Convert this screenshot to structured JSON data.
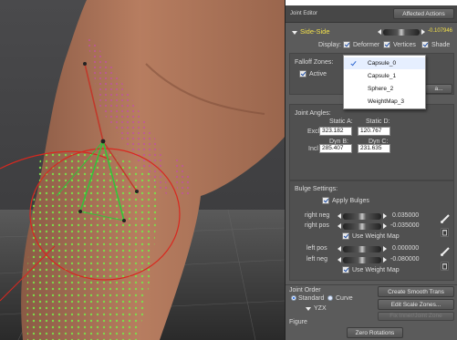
{
  "panel": {
    "title": "Joint Editor",
    "affected_actions_label": "Affected Actions",
    "parameter_name": "Side-Side",
    "parameter_value": "-0.107946",
    "display_label": "Display:",
    "display_options": [
      {
        "label": "Deformer",
        "checked": true
      },
      {
        "label": "Vertices",
        "checked": true
      },
      {
        "label": "Shade",
        "checked": false
      }
    ]
  },
  "falloff": {
    "label": "Falloff Zones:",
    "active_label": "Active",
    "button_label": "a...",
    "menu_items": [
      {
        "label": "Capsule_0",
        "selected": true
      },
      {
        "label": "Capsule_1",
        "selected": false
      },
      {
        "label": "Sphere_2",
        "selected": false
      },
      {
        "label": "WeightMap_3",
        "selected": false
      }
    ]
  },
  "joint_angles": {
    "title": "Joint Angles:",
    "static_a_label": "Static A:",
    "static_d_label": "Static D:",
    "excl_label": "Excl",
    "static_a_value": "323.182",
    "static_d_value": "120.767",
    "dyn_b_label": "Dyn B:",
    "dyn_c_label": "Dyn C:",
    "incl_label": "Incl",
    "dyn_b_value": "285.407",
    "dyn_c_value": "231.635"
  },
  "bulge": {
    "title": "Bulge Settings:",
    "apply_label": "Apply Bulges",
    "right_neg_label": "right neg",
    "right_neg_value": "0.035000",
    "right_pos_label": "right pos",
    "right_pos_value": "-0.035000",
    "use_weight_map_label": "Use Weight Map",
    "left_pos_label": "left pos",
    "left_pos_value": "0.000000",
    "left_neg_label": "left neg",
    "left_neg_value": "-0.080000"
  },
  "joint_order": {
    "title": "Joint Order",
    "standard_label": "Standard",
    "curve_label": "Curve",
    "order_value": "YZX",
    "create_smooth_label": "Create Smooth Trans",
    "edit_scale_label": "Edit Scale Zones...",
    "fix_label": "Fix Inner/Joint Zone",
    "figure_label": "Figure",
    "zero_rotations_label": "Zero Rotations"
  },
  "colors": {
    "panel_bg": "#5b5b5b",
    "accent_yellow": "#f3e04a",
    "bone_red": "#c0392b",
    "bone_green": "#34c13a",
    "dots_green": "#7be04a",
    "dots_pink": "#d05bb0"
  }
}
